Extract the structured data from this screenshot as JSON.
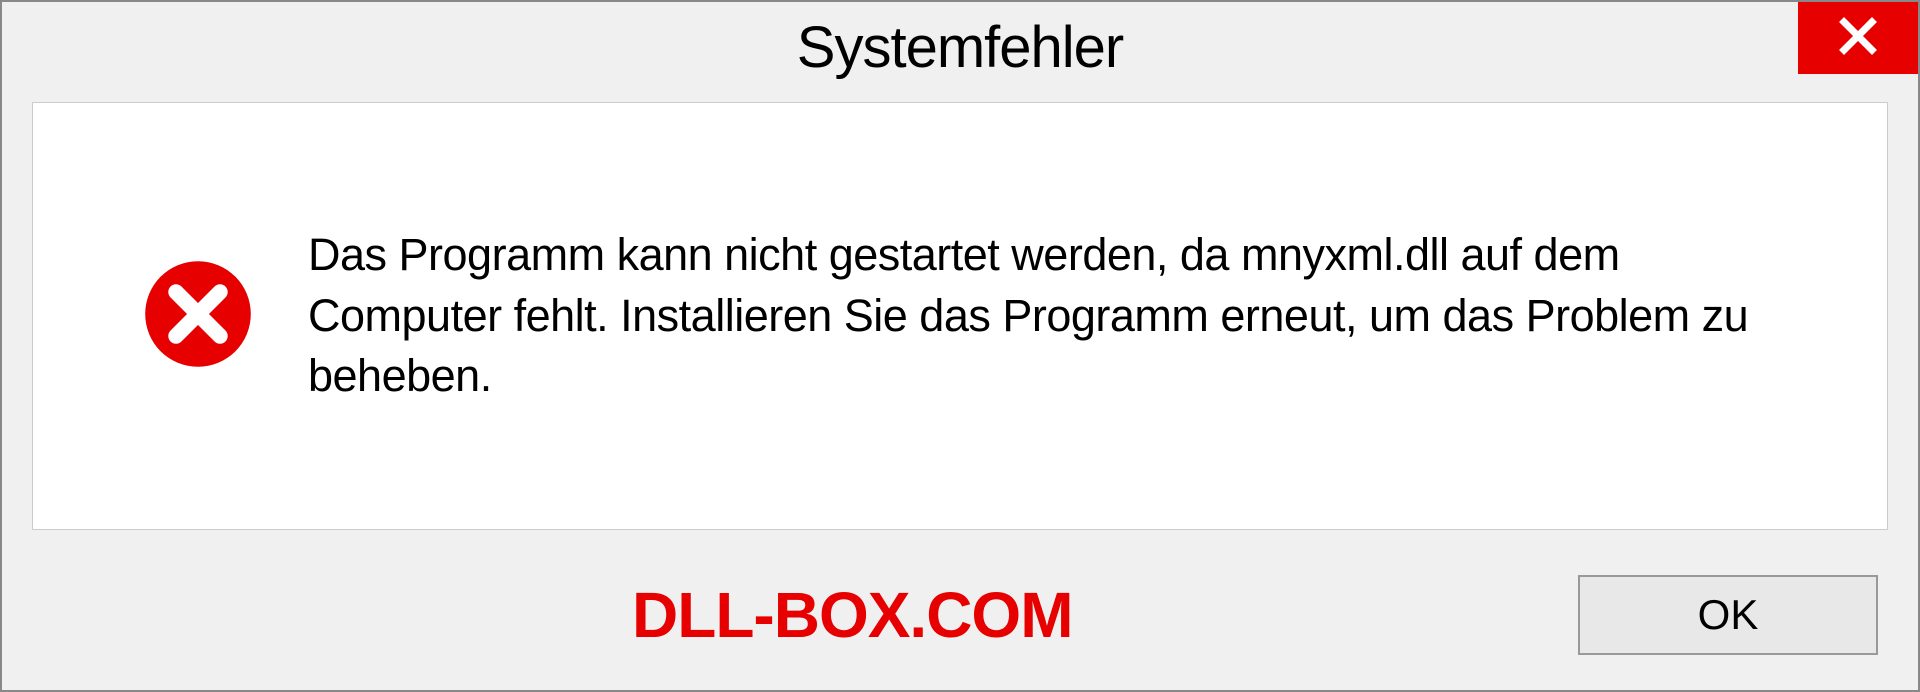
{
  "titlebar": {
    "title": "Systemfehler"
  },
  "content": {
    "message": "Das Programm kann nicht gestartet werden, da mnyxml.dll auf dem Computer fehlt. Installieren Sie das Programm erneut, um das Problem zu beheben."
  },
  "bottom": {
    "watermark": "DLL-BOX.COM",
    "ok_label": "OK"
  }
}
